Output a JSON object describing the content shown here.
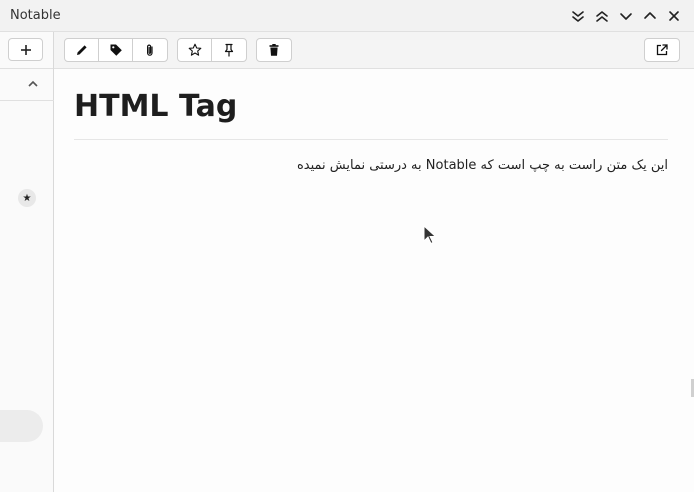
{
  "window": {
    "title": "Notable",
    "controls": [
      "collapse-all",
      "expand-all",
      "next",
      "previous",
      "close"
    ]
  },
  "sidebar": {
    "new_button": "+",
    "collapse_icon": "chevron-up-icon",
    "star_badge": "★"
  },
  "toolbar": {
    "group1": [
      "edit-icon",
      "tag-icon",
      "attachment-icon"
    ],
    "group2": [
      "star-icon",
      "pin-icon"
    ],
    "group3": [
      "trash-icon"
    ],
    "open_external": "external-link-icon"
  },
  "note": {
    "title": "HTML Tag",
    "body": "این یک متن راست به چپ است که Notable به درستی نمایش نمیده"
  }
}
